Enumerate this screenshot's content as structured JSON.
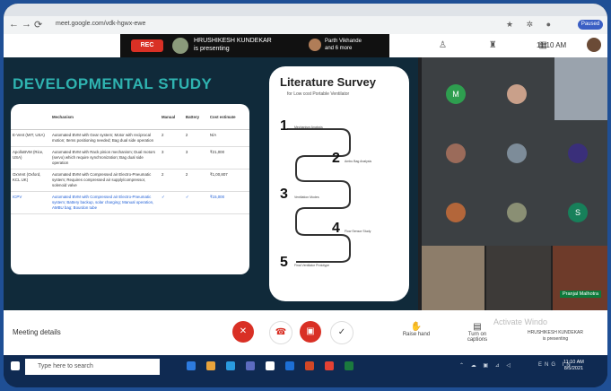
{
  "browser": {
    "url": "meet.google.com/vdk-hgwx-ewe",
    "user_badge": "Paused"
  },
  "meet": {
    "rec_label": "REC",
    "presenter_name": "HRUSHIKESH KUNDEKAR",
    "presenter_status": "is presenting",
    "participant_name": "Parth Vikhande",
    "participant_status": "and 6 more",
    "clock": "11:10 AM"
  },
  "slide": {
    "title": "DEVELOPMENTAL STUDY",
    "table": {
      "headers": [
        "",
        "Mechanism",
        "Manual",
        "Battery",
        "Cost estimate"
      ],
      "rows": [
        [
          "E-Vent (MIT, USA)",
          "Automated BVM with Gear system; Motor with reciprocal motion; Items positioning needed; Bag dual side operation",
          "2",
          "2",
          "N/A"
        ],
        [
          "ApolloBVM (Rice, USA)",
          "Automated BVM with Rack pinion mechanism; Dual motors (servo) which require synchronization; Bag dual side operation",
          "3",
          "3",
          "₹21,000"
        ],
        [
          "OxVent (Oxford, KCL UK)",
          "Automated BVM with Compressed air Electro-Pneumatic system; Requires compressed air supply/compressor, solenoid valve",
          "2",
          "2",
          "₹1,00,807"
        ],
        [
          "ICPV",
          "Automated BVM with Compressed air Electro-Pneumatic system; Battery backup, solar charging; Manual operation, AMBU bag; Bourdon tube",
          "✓",
          "✓",
          "₹15,000"
        ]
      ]
    },
    "lit": {
      "title": "Literature Survey",
      "subtitle": "for Low cost Portable Ventilator",
      "steps": [
        {
          "n": "1",
          "label": "Mechanism Analysis"
        },
        {
          "n": "2",
          "label": "Ambu Bag Analysis"
        },
        {
          "n": "3",
          "label": "Ventilation Modes"
        },
        {
          "n": "4",
          "label": "Flow Sensor Study"
        },
        {
          "n": "5",
          "label": "Final Ventilator Prototype"
        }
      ]
    }
  },
  "grid": {
    "tiles": [
      {
        "initial": "M",
        "color": "#2e9e4f"
      },
      {
        "initial": "",
        "color": "#c9a08a"
      },
      {
        "initial": "",
        "color": "#9b6b5a"
      },
      {
        "initial": "",
        "color": "#7d8c99"
      },
      {
        "initial": "",
        "color": "#3a2f7a"
      },
      {
        "initial": "",
        "color": "#b3663a"
      },
      {
        "initial": "",
        "color": "#8a8f74"
      },
      {
        "initial": "S",
        "color": "#17805a"
      }
    ],
    "pinned_name": "Pranjal Malhotra"
  },
  "controls": {
    "meeting_details": "Meeting details",
    "raise_hand": "Raise hand",
    "captions": "Turn on captions",
    "presenting_name": "HRUSHIKESH KUNDEKAR",
    "presenting_status": "is presenting",
    "activate": "Activate Windo"
  },
  "taskbar": {
    "search_placeholder": "Type here to search",
    "time": "11:10 AM",
    "date": "8/5/2021",
    "lang": "ENG IN"
  }
}
